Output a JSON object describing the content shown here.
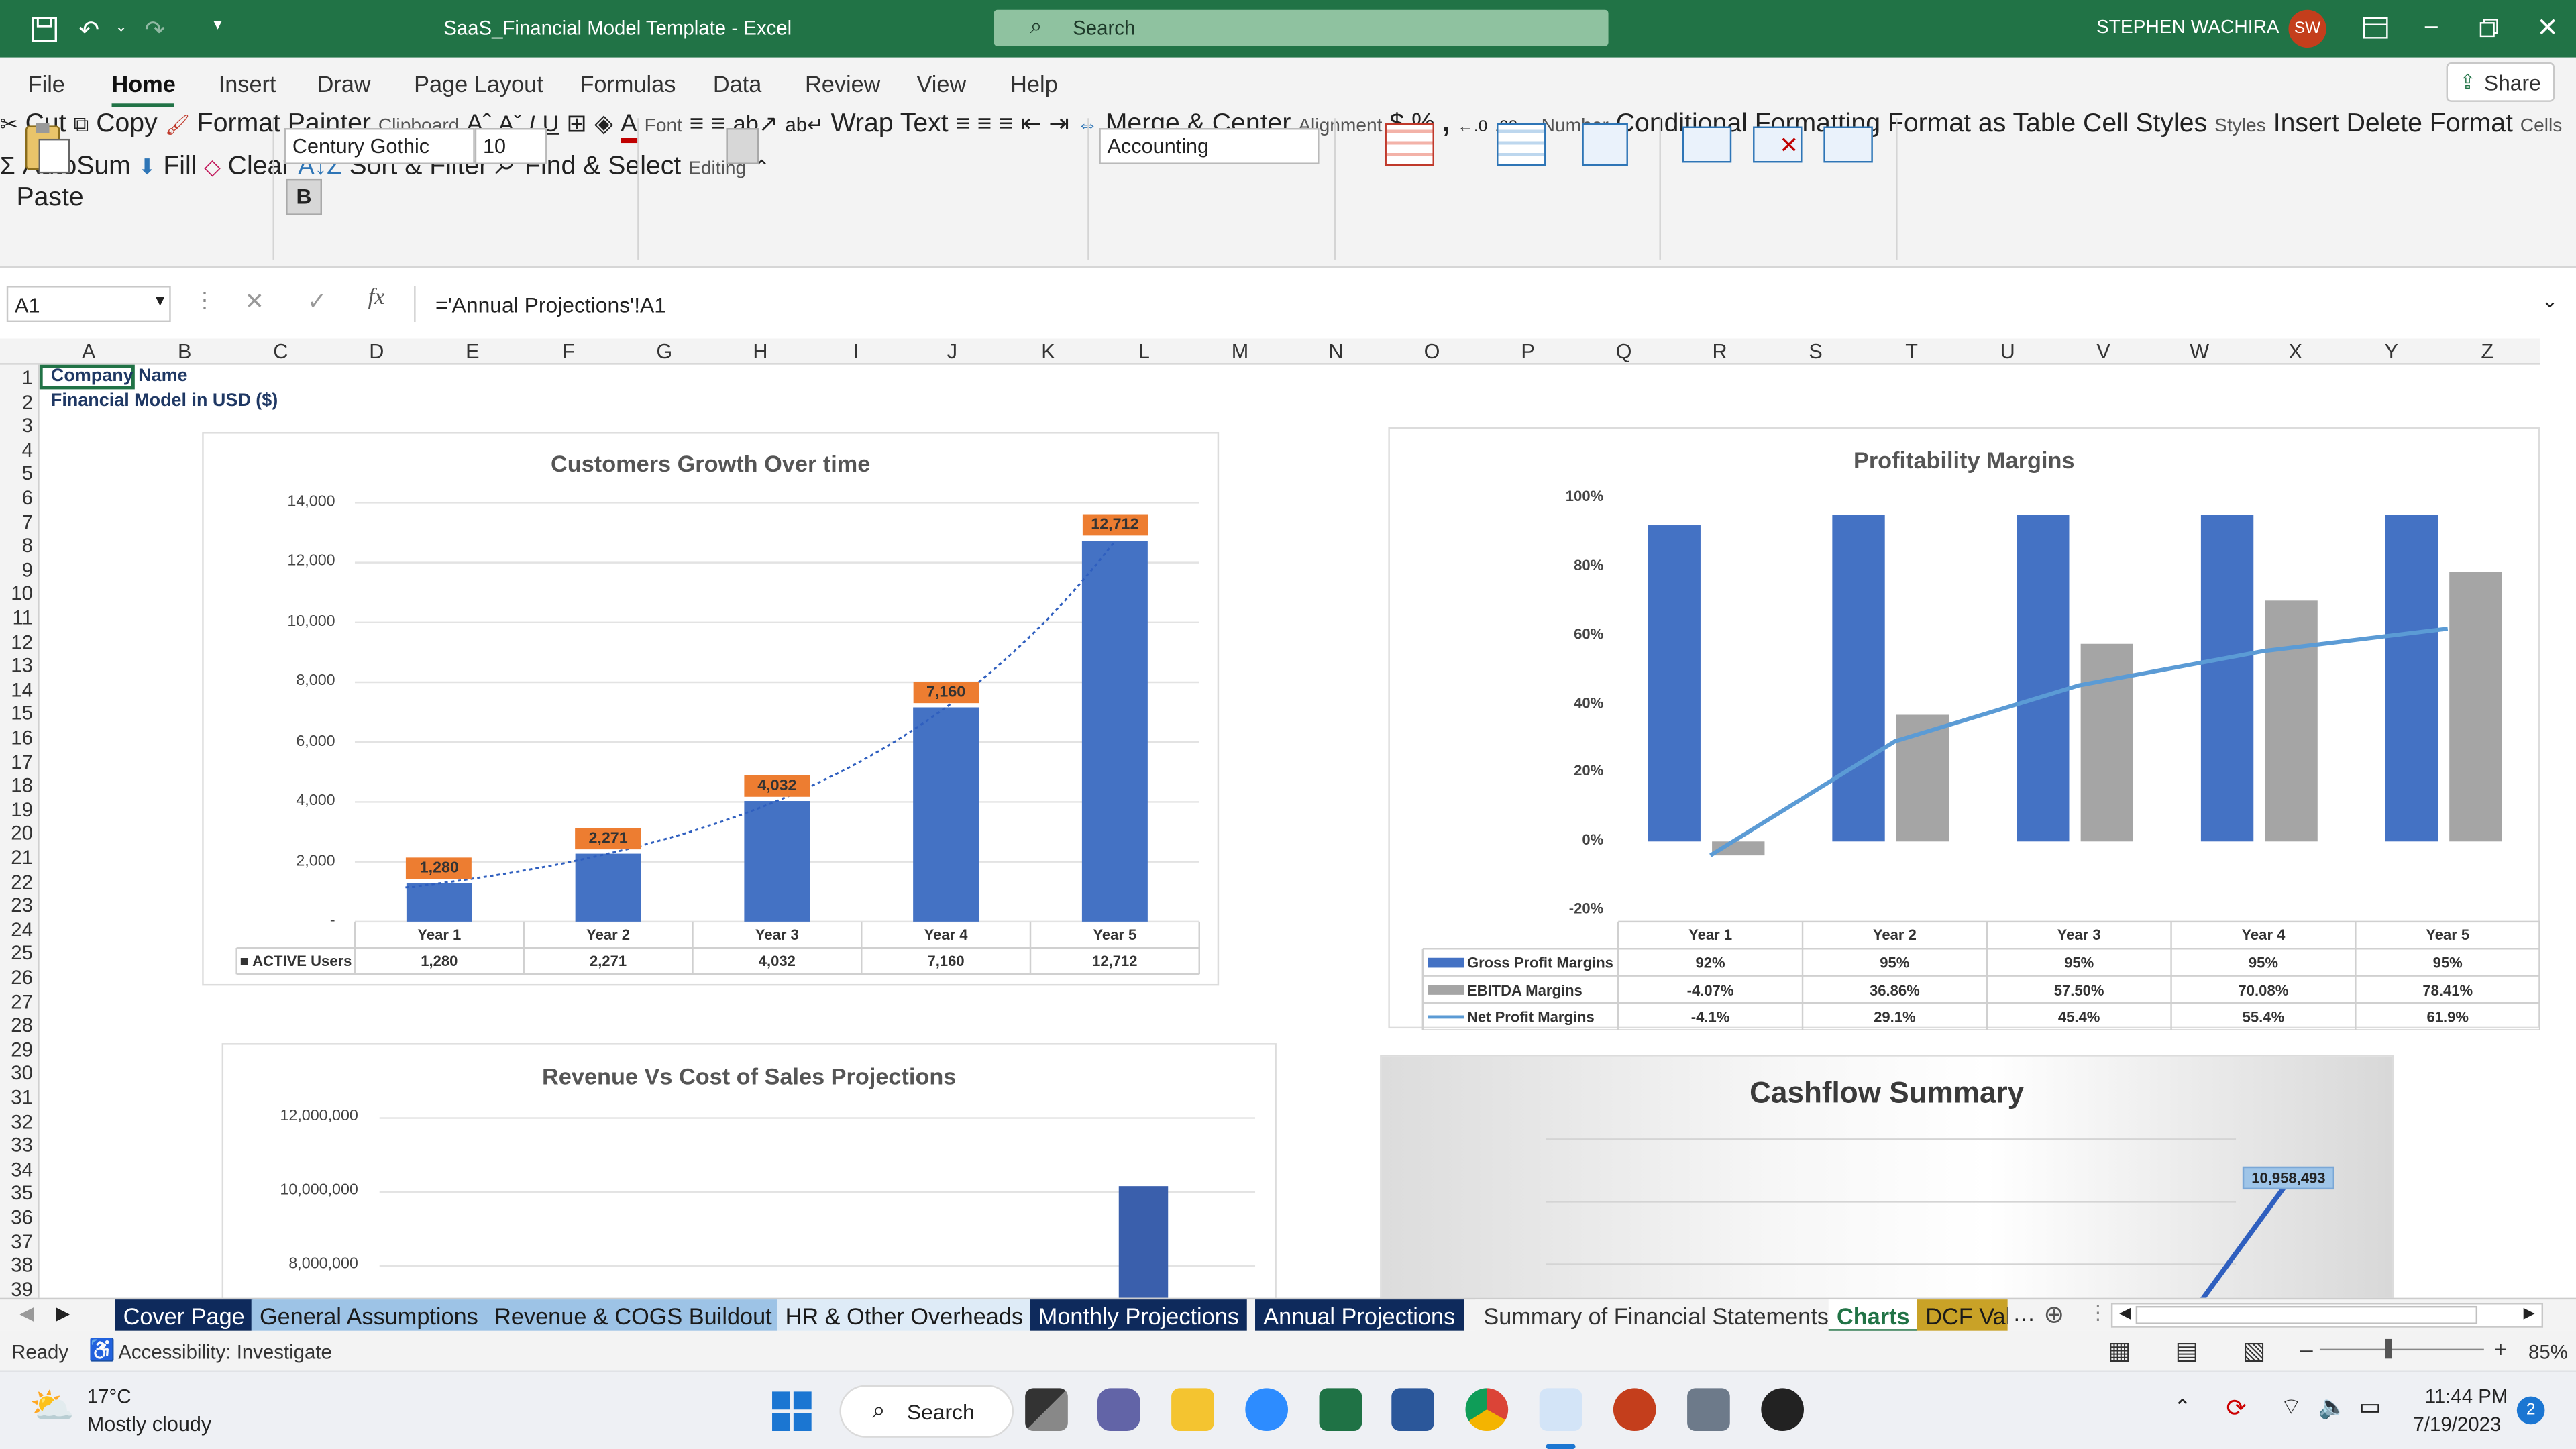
{
  "window": {
    "title": "SaaS_Financial Model Template  -  Excel",
    "search_placeholder": "Search",
    "user_name": "STEPHEN WACHIRA",
    "user_initials": "SW"
  },
  "ribbon_tabs": [
    "File",
    "Home",
    "Insert",
    "Draw",
    "Page Layout",
    "Formulas",
    "Data",
    "Review",
    "View",
    "Help"
  ],
  "share_label": "Share",
  "ribbon": {
    "paste": "Paste",
    "cut": "Cut",
    "copy": "Copy",
    "format_painter": "Format Painter",
    "clipboard": "Clipboard",
    "font_name": "Century Gothic",
    "font_size": "10",
    "font_group": "Font",
    "wrap_text": "Wrap Text",
    "merge_center": "Merge & Center",
    "alignment_group": "Alignment",
    "number_format": "Accounting",
    "number_group": "Number",
    "conditional_formatting_1": "Conditional",
    "conditional_formatting_2": "Formatting",
    "format_as_table_1": "Format as",
    "format_as_table_2": "Table",
    "cell_styles_1": "Cell",
    "cell_styles_2": "Styles",
    "styles_group": "Styles",
    "insert": "Insert",
    "delete": "Delete",
    "format": "Format",
    "cells_group": "Cells",
    "autosum": "AutoSum",
    "fill": "Fill",
    "clear": "Clear",
    "sort_filter_1": "Sort &",
    "sort_filter_2": "Filter",
    "find_select_1": "Find &",
    "find_select_2": "Select",
    "editing_group": "Editing"
  },
  "formula_bar": {
    "name_box": "A1",
    "formula": "='Annual Projections'!A1"
  },
  "columns": [
    "A",
    "B",
    "C",
    "D",
    "E",
    "F",
    "G",
    "H",
    "I",
    "J",
    "K",
    "L",
    "M",
    "N",
    "O",
    "P",
    "Q",
    "R",
    "S",
    "T",
    "U",
    "V",
    "W",
    "X",
    "Y",
    "Z"
  ],
  "rows": [
    "1",
    "2",
    "3",
    "4",
    "5",
    "6",
    "7",
    "8",
    "9",
    "10",
    "11",
    "12",
    "13",
    "14",
    "15",
    "16",
    "17",
    "18",
    "19",
    "20",
    "21",
    "22",
    "23",
    "24",
    "25",
    "26",
    "27",
    "28",
    "29",
    "30",
    "31",
    "32",
    "33",
    "34",
    "35",
    "36",
    "37",
    "38",
    "39"
  ],
  "cells": {
    "a1": "Company Name",
    "a2": "Financial  Model in USD ($)"
  },
  "chart_data": [
    {
      "type": "bar",
      "title": "Customers Growth Over time",
      "categories": [
        "Year 1",
        "Year 2",
        "Year 3",
        "Year 4",
        "Year 5"
      ],
      "series": [
        {
          "name": "ACTIVE Users",
          "values": [
            1280,
            2271,
            4032,
            7160,
            12712
          ]
        }
      ],
      "data_labels": [
        "1,280",
        "2,271",
        "4,032",
        "7,160",
        "12,712"
      ],
      "y_ticks": [
        "14,000",
        "12,000",
        "10,000",
        "8,000",
        "6,000",
        "4,000",
        "2,000",
        "-"
      ],
      "ylim": [
        0,
        14000
      ],
      "trendline": "exponential (dotted)",
      "data_table": true
    },
    {
      "type": "bar",
      "title": "Profitability Margins",
      "categories": [
        "Year 1",
        "Year 2",
        "Year 3",
        "Year 4",
        "Year 5"
      ],
      "series": [
        {
          "name": "Gross Profit Margins",
          "values": [
            92,
            95,
            95,
            95,
            95
          ],
          "labels": [
            "92%",
            "95%",
            "95%",
            "95%",
            "95%"
          ]
        },
        {
          "name": "EBITDA Margins",
          "values": [
            -4.07,
            36.86,
            57.5,
            70.08,
            78.41
          ],
          "labels": [
            "-4.07%",
            "36.86%",
            "57.50%",
            "70.08%",
            "78.41%"
          ]
        },
        {
          "name": "Net Profit Margins",
          "type": "line",
          "values": [
            -4.1,
            29.1,
            45.4,
            55.4,
            61.9
          ],
          "labels": [
            "-4.1%",
            "29.1%",
            "45.4%",
            "55.4%",
            "61.9%"
          ]
        }
      ],
      "y_ticks": [
        "100%",
        "80%",
        "60%",
        "40%",
        "20%",
        "0%",
        "-20%"
      ],
      "ylim": [
        -20,
        100
      ],
      "data_table": true
    },
    {
      "type": "bar",
      "title": "Revenue Vs Cost of Sales Projections",
      "y_ticks": [
        "12,000,000",
        "10,000,000",
        "8,000,000"
      ],
      "note": "partially visible; one bar visible near 10,000,000"
    },
    {
      "type": "line",
      "title": "Cashflow Summary",
      "data_labels": [
        "10,958,493"
      ],
      "note": "partially visible"
    }
  ],
  "sheet_tabs": [
    {
      "label": "Cover Page",
      "bg": "#0E2A5C",
      "fg": "#ffffff"
    },
    {
      "label": "General Assumptions",
      "bg": "#9DC3E6",
      "fg": "#1a1a1a"
    },
    {
      "label": "Revenue & COGS Buildout",
      "bg": "#9DC3E6",
      "fg": "#1a1a1a"
    },
    {
      "label": "HR & Other Overheads",
      "bg": "#DEEBF7",
      "fg": "#1a1a1a"
    },
    {
      "label": "Monthly Projections",
      "bg": "#0E2A5C",
      "fg": "#ffffff"
    },
    {
      "label": "Annual Projections",
      "bg": "#0E2A5C",
      "fg": "#ffffff"
    },
    {
      "label": "Summary of Financial Statements",
      "bg": "#f3f3f3",
      "fg": "#333333"
    },
    {
      "label": "Charts",
      "bg": "#ffffff",
      "fg": "#217346"
    },
    {
      "label": "DCF Val",
      "bg": "#C9A227",
      "fg": "#1a1a1a"
    }
  ],
  "status_bar": {
    "ready": "Ready",
    "accessibility": "Accessibility: Investigate",
    "zoom": "85%"
  },
  "taskbar": {
    "weather_temp": "17°C",
    "weather_desc": "Mostly cloudy",
    "search": "Search",
    "time": "11:44 PM",
    "date": "7/19/2023",
    "notifications": "2"
  },
  "colors": {
    "excel_green": "#217346",
    "bar_blue": "#4472C4",
    "label_orange": "#ED7D31",
    "ebitda_gray": "#A5A5A5",
    "line_blue": "#5B9BD5"
  }
}
